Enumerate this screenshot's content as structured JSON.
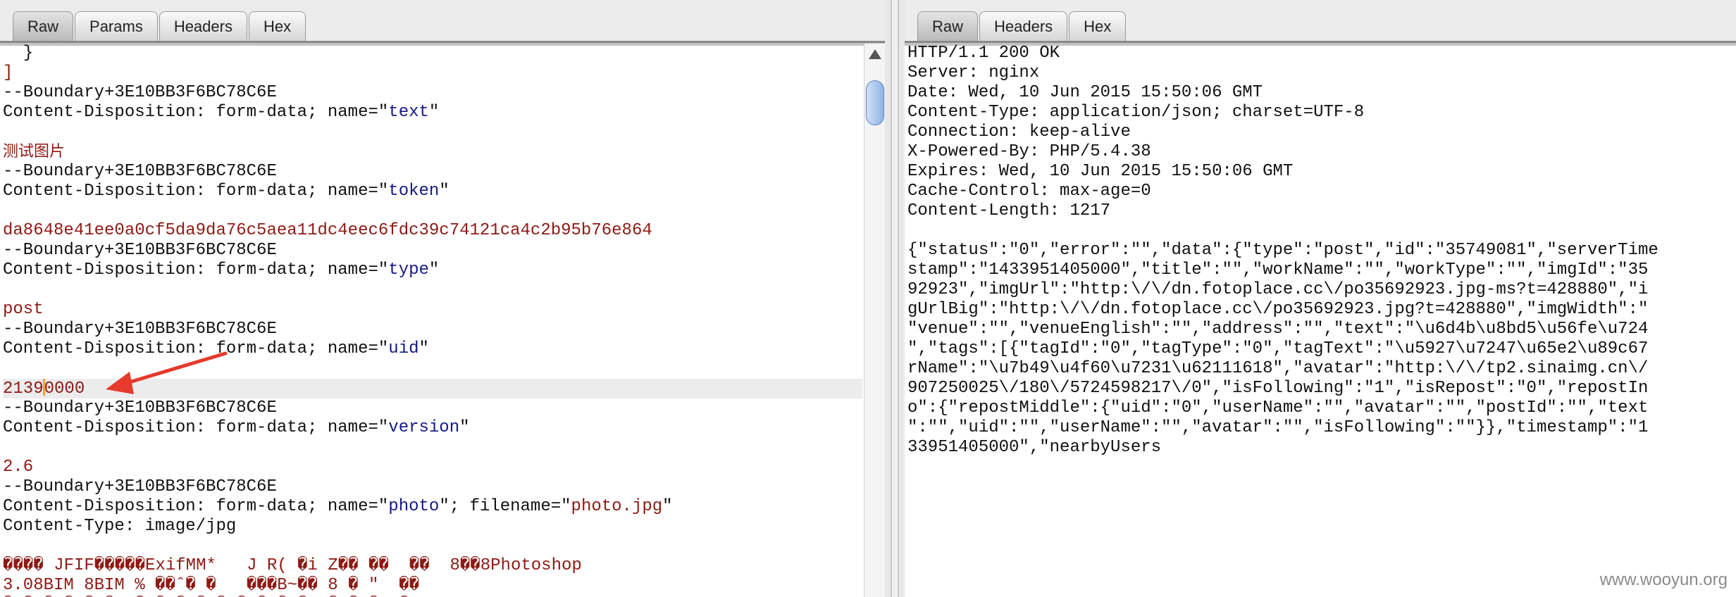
{
  "request_panel": {
    "tabs": [
      {
        "label": "Raw",
        "active": true
      },
      {
        "label": "Params",
        "active": false
      },
      {
        "label": "Headers",
        "active": false
      },
      {
        "label": "Hex",
        "active": false
      }
    ],
    "lines": [
      [
        {
          "t": "  }",
          "c": "black"
        }
      ],
      [
        {
          "t": "]",
          "c": "red"
        }
      ],
      [
        {
          "t": "--Boundary+3E10BB3F6BC78C6E",
          "c": "black"
        }
      ],
      [
        {
          "t": "Content-Disposition: form-data; name=\"",
          "c": "black"
        },
        {
          "t": "text",
          "c": "blue"
        },
        {
          "t": "\"",
          "c": "black"
        }
      ],
      [],
      [
        {
          "t": "测试图片",
          "c": "red",
          "cjk": true
        }
      ],
      [
        {
          "t": "--Boundary+3E10BB3F6BC78C6E",
          "c": "black"
        }
      ],
      [
        {
          "t": "Content-Disposition: form-data; name=\"",
          "c": "black"
        },
        {
          "t": "token",
          "c": "blue"
        },
        {
          "t": "\"",
          "c": "black"
        }
      ],
      [],
      [
        {
          "t": "da8648e41ee0a0cf5da9da76c5aea11dc4eec6fdc39c74121ca4c2b95b76e864",
          "c": "red"
        }
      ],
      [
        {
          "t": "--Boundary+3E10BB3F6BC78C6E",
          "c": "black"
        }
      ],
      [
        {
          "t": "Content-Disposition: form-data; name=\"",
          "c": "black"
        },
        {
          "t": "type",
          "c": "blue"
        },
        {
          "t": "\"",
          "c": "black"
        }
      ],
      [],
      [
        {
          "t": "post",
          "c": "red"
        }
      ],
      [
        {
          "t": "--Boundary+3E10BB3F6BC78C6E",
          "c": "black"
        }
      ],
      [
        {
          "t": "Content-Disposition: form-data; name=\"",
          "c": "black"
        },
        {
          "t": "uid",
          "c": "blue"
        },
        {
          "t": "\"",
          "c": "black"
        }
      ],
      [],
      [
        {
          "t": "2139",
          "c": "red"
        },
        {
          "caret": true
        },
        {
          "t": "0000",
          "c": "red"
        }
      ],
      [
        {
          "t": "--Boundary+3E10BB3F6BC78C6E",
          "c": "black"
        }
      ],
      [
        {
          "t": "Content-Disposition: form-data; name=\"",
          "c": "black"
        },
        {
          "t": "version",
          "c": "blue"
        },
        {
          "t": "\"",
          "c": "black"
        }
      ],
      [],
      [
        {
          "t": "2.6",
          "c": "red"
        }
      ],
      [
        {
          "t": "--Boundary+3E10BB3F6BC78C6E",
          "c": "black"
        }
      ],
      [
        {
          "t": "Content-Disposition: form-data; name=\"",
          "c": "black"
        },
        {
          "t": "photo",
          "c": "blue"
        },
        {
          "t": "\"; filename=\"",
          "c": "black"
        },
        {
          "t": "photo.jpg",
          "c": "red"
        },
        {
          "t": "\"",
          "c": "black"
        }
      ],
      [
        {
          "t": "Content-Type: image/jpg",
          "c": "black"
        }
      ],
      [],
      [
        {
          "t": "���� JFIF�����ExifMM*   J R( �i Z�� ��  ��  8��8Photoshop",
          "c": "red"
        }
      ],
      [
        {
          "t": "3.08BIM 8BIM % ��ˆ� �   ���B~�� 8 � \"  ��",
          "c": "red"
        }
      ],
      [
        {
          "t": "� � � � � �  � � � � � � � � �  � � �  �",
          "c": "red"
        }
      ]
    ],
    "highlighted_line": 17
  },
  "response_panel": {
    "tabs": [
      {
        "label": "Raw",
        "active": true
      },
      {
        "label": "Headers",
        "active": false
      },
      {
        "label": "Hex",
        "active": false
      }
    ],
    "lines": [
      "HTTP/1.1 200 OK",
      "Server: nginx",
      "Date: Wed, 10 Jun 2015 15:50:06 GMT",
      "Content-Type: application/json; charset=UTF-8",
      "Connection: keep-alive",
      "X-Powered-By: PHP/5.4.38",
      "Expires: Wed, 10 Jun 2015 15:50:06 GMT",
      "Cache-Control: max-age=0",
      "Content-Length: 1217",
      "",
      "{\"status\":\"0\",\"error\":\"\",\"data\":{\"type\":\"post\",\"id\":\"35749081\",\"serverTime",
      "stamp\":\"1433951405000\",\"title\":\"\",\"workName\":\"\",\"workType\":\"\",\"imgId\":\"35",
      "92923\",\"imgUrl\":\"http:\\/\\/dn.fotoplace.cc\\/po35692923.jpg-ms?t=428880\",\"i",
      "gUrlBig\":\"http:\\/\\/dn.fotoplace.cc\\/po35692923.jpg?t=428880\",\"imgWidth\":\"",
      "\"venue\":\"\",\"venueEnglish\":\"\",\"address\":\"\",\"text\":\"\\u6d4b\\u8bd5\\u56fe\\u724",
      "\",\"tags\":[{\"tagId\":\"0\",\"tagType\":\"0\",\"tagText\":\"\\u5927\\u7247\\u65e2\\u89c67",
      "rName\":\"\\u7b49\\u4f60\\u7231\\u62111618\",\"avatar\":\"http:\\/\\/tp2.sinaimg.cn\\/",
      "907250025\\/180\\/5724598217\\/0\",\"isFollowing\":\"1\",\"isRepost\":\"0\",\"repostIn",
      "o\":{\"repostMiddle\":{\"uid\":\"0\",\"userName\":\"\",\"avatar\":\"\",\"postId\":\"\",\"text",
      "\":\"\",\"uid\":\"\",\"userName\":\"\",\"avatar\":\"\",\"isFollowing\":\"\"}},\"timestamp\":\"1",
      "33951405000\",\"nearbyUsers"
    ]
  },
  "watermark": "www.wooyun.org",
  "colors": {
    "black": "#111111",
    "red": "#8e1a14",
    "blue": "#151a86",
    "arrow": "#e53a2c"
  }
}
